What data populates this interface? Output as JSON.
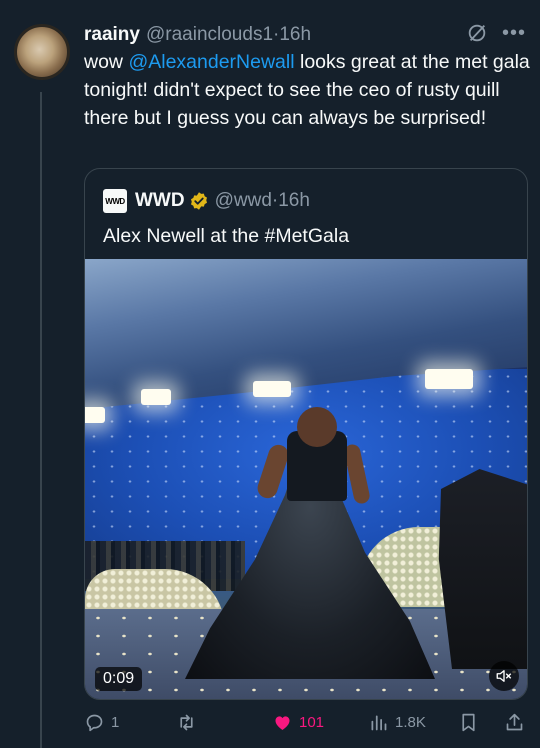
{
  "tweet": {
    "author_name": "raainy",
    "author_handle": "@raainclouds1",
    "separator": "·",
    "time": "16h",
    "text_before": "wow ",
    "mention": "@AlexanderNewall",
    "text_after": " looks great at the met gala tonight! didn't expect to see the ceo of rusty quill there but I guess you can always be surprised!"
  },
  "quote": {
    "logo_text": "WWD",
    "name": "WWD",
    "handle": "@wwd",
    "separator": "·",
    "time": "16h",
    "text": "Alex Newell at the #MetGala",
    "video_time": "0:09"
  },
  "actions": {
    "replies": "1",
    "retweets": "",
    "likes": "101",
    "views": "1.8K"
  },
  "colors": {
    "background": "#15202b",
    "mention": "#1d9bf0",
    "like": "#f91880",
    "muted": "#8b98a5",
    "verified": "#e2b719"
  }
}
